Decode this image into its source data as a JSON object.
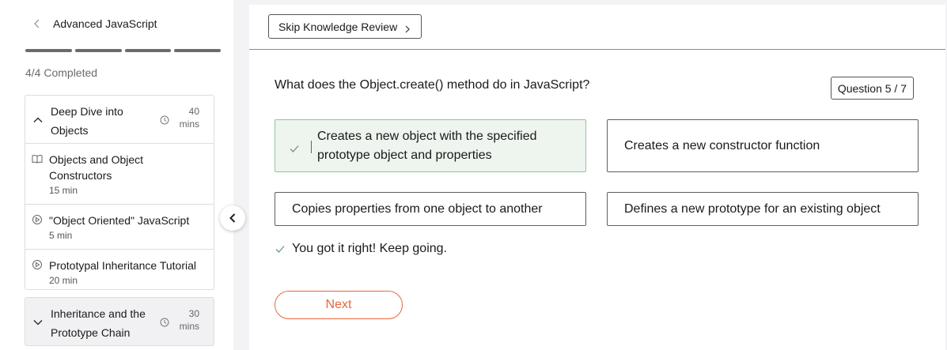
{
  "sidebar": {
    "course_title": "Advanced JavaScript",
    "progress": {
      "completed": 4,
      "total": 4,
      "label": "4/4 Completed"
    },
    "modules": [
      {
        "title": "Deep Dive into Objects",
        "duration_value": "40",
        "duration_unit": "mins",
        "expanded": true,
        "lessons": [
          {
            "title": "Objects and Object Constructors",
            "duration": "15 min",
            "icon": "book-icon"
          },
          {
            "title": "\"Object Oriented\" JavaScript",
            "duration": "5 min",
            "icon": "play-circle-icon"
          },
          {
            "title": "Prototypal Inheritance Tutorial",
            "duration": "20 min",
            "icon": "play-circle-icon"
          }
        ]
      },
      {
        "title": "Inheritance and the Prototype Chain",
        "duration_value": "30",
        "duration_unit": "mins",
        "expanded": false
      }
    ]
  },
  "quiz": {
    "skip_label": "Skip Knowledge Review",
    "question": "What does the Object.create() method do in JavaScript?",
    "counter": "Question 5 / 7",
    "options": [
      {
        "text": "Creates a new object with the specified prototype object and properties",
        "selected": true,
        "correct": true
      },
      {
        "text": "Creates a new constructor function",
        "selected": false
      },
      {
        "text": "Copies properties from one object to another",
        "selected": false
      },
      {
        "text": "Defines a new prototype for an existing object",
        "selected": false
      }
    ],
    "feedback": "You got it right! Keep going.",
    "next_label": "Next"
  },
  "colors": {
    "accent": "#e8673c",
    "correct_bg": "#eef5ef",
    "correct_border": "#8fc59a",
    "check": "#6c9a74"
  }
}
